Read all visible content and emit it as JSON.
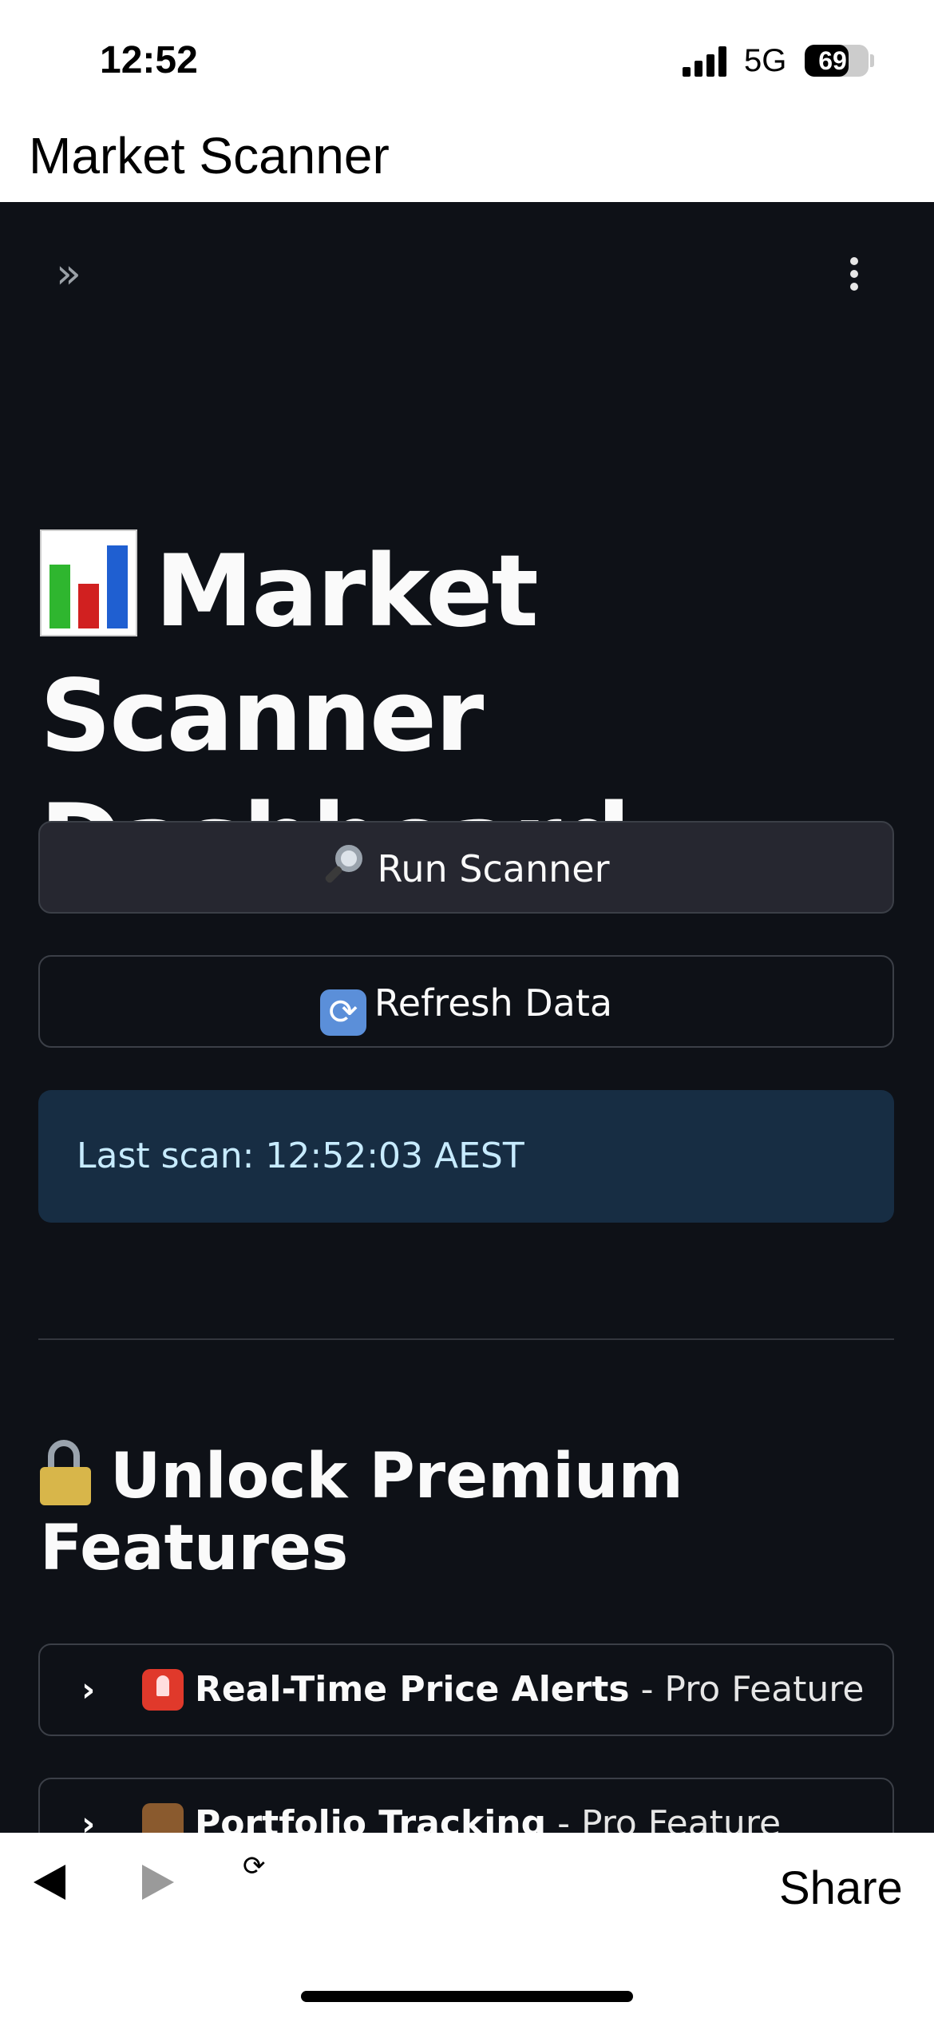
{
  "status_bar": {
    "time": "12:52",
    "network": "5G",
    "battery_percent": "69",
    "battery_level": 0.69
  },
  "browser": {
    "page_title": "Market Scanner",
    "share_label": "Share"
  },
  "app": {
    "title": "Market Scanner Dashboard",
    "title_icon": "bar-chart-icon",
    "run_button": {
      "icon": "magnifier-icon",
      "label": "Run Scanner"
    },
    "refresh_button": {
      "icon": "refresh-icon",
      "label": "Refresh Data"
    },
    "info": "Last scan: 12:52:03 AEST",
    "premium_section": {
      "icon": "lock-icon",
      "title": "Unlock Premium Features",
      "expanders": [
        {
          "icon": "siren-icon",
          "title": "Real-Time Price Alerts",
          "suffix": " - Pro Feature"
        },
        {
          "icon": "briefcase-icon",
          "title": "Portfolio Tracking",
          "suffix": " - Pro Feature"
        }
      ]
    }
  },
  "colors": {
    "app_background": "#0e1117",
    "info_background": "#172d43",
    "info_text": "#c7ebff",
    "button_background": "#262730"
  }
}
